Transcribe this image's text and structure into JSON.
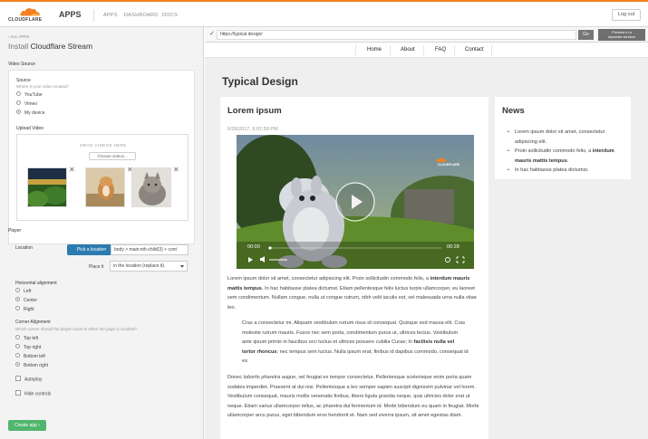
{
  "header": {
    "logo_text": "CLOUDFLARE",
    "app_title": "APPS",
    "nav": [
      "APPS",
      "DASHBOARD",
      "DOCS"
    ],
    "logout": "Log out",
    "accent_color": "#f38020"
  },
  "left_panel": {
    "back_link": "‹ ALL APPS",
    "install_prefix": "Install ",
    "install_app_name": "Cloudflare Stream",
    "video_source": {
      "section_title": "Video Source",
      "source_label": "Source",
      "source_hint": "Where is your video located?",
      "options": [
        "YouTube",
        "Vimeo",
        "My device"
      ],
      "selected": "My device",
      "upload_label": "Upload Video",
      "drag_text": "DRAG VIDEOS HERE",
      "choose_button": "Choose videos..."
    },
    "player": {
      "section_title": "Player",
      "location_label": "Location",
      "pick_button": "Pick a location",
      "selector_value": "body > main:nth-child(3) > cont",
      "place_label": "Place it",
      "place_value": "in the location (replace it).",
      "h_align_label": "Horizontal alignment",
      "h_align_options": [
        "Left",
        "Center",
        "Right"
      ],
      "h_align_selected": "Center",
      "corner_label": "Corner Alignment",
      "corner_hint": "Which corner should the player move to when the page is scrolled?",
      "corner_options": [
        "Top left",
        "Top right",
        "Bottom left",
        "Bottom right"
      ],
      "corner_selected": "Bottom right",
      "autoplay_label": "Autoplay",
      "hide_controls_label": "Hide controls"
    },
    "create_button": "Create app ›"
  },
  "preview": {
    "url": "https://typical.design/",
    "go_button": "Go",
    "separate_window_line1": "Preview in a",
    "separate_window_line2": "separate window",
    "site_nav": [
      "Home",
      "About",
      "FAQ",
      "Contact"
    ],
    "site_title": "Typical Design",
    "article": {
      "title": "Lorem ipsum",
      "date": "6/26/2017, 6:01:59 PM",
      "video_time_current": "00:00",
      "video_time_total": "00:28",
      "video_logo": "CLOUDFLARE",
      "p1_a": "Lorem ipsum dolor sit amet, consectetur adipiscing elit. Proin sollicitudin commodo felis, a ",
      "p1_b": "interdum mauris mattis tempus",
      "p1_c": ". In hac habitasse platea dictumst. Etiam pellentesque felis luctus turpis ullamcorper, eu laoreet sem condimentum. Nullam congue, nulla ut congue rutrum, nibh velit iaculis est, vel malesuada urna nulla vitae leo.",
      "quote_a": "Cras a consectetur mi. Aliquam vestibulum rutrum risus id consequat. Quisque sed massa elit. Cras molestie rutrum mauris. Fusce nec sem porta, condimentum purus ut, ultrices lectus. Vestibulum ante ipsum primis in faucibus orci luctus et ultrices posuere cubilia Curae; In ",
      "quote_b": "facilisis nulla vel tortor rhoncus",
      "quote_c": "; nec tempus sem luctus. Nulla ipsum erat, finibus id dapibus commodo, consequat id ex.",
      "p2_a": "Donec ",
      "p2_b": "lobortis pharetra",
      "p2_c": " augue, vel feugiat ex tempor consectetur. Pellentesque scelerisque enim porta quam sodales imperdiet. Praesent at dui nisi. Pellentesque a leo semper sapien suscipit dignissim pulvinar vel lorem. Vestibulum consequat, mauris mollis venenatis finibus, libero ligula gravida neque, quis ultricies dolor erat ut neque. Etiam varius ullamcorper tellus, ac pharetra dui fermentum id. Morbi bibendum eu quam in feugiat. Morbi ullamcorper arcu purus, eget bibendum eros hendrerit et. Nam sed viverra ipsum, sit amet egestas diam."
    },
    "news": {
      "title": "News",
      "item1": "Lorem ipsum dolor sit amet, consectetur adipiscing elit.",
      "item2_a": "Proin sollicitudin commodo felis, a ",
      "item2_b": "interdum mauris mattis tempus",
      "item2_c": ".",
      "item3": "In hac habitasse platea dictumst."
    }
  }
}
